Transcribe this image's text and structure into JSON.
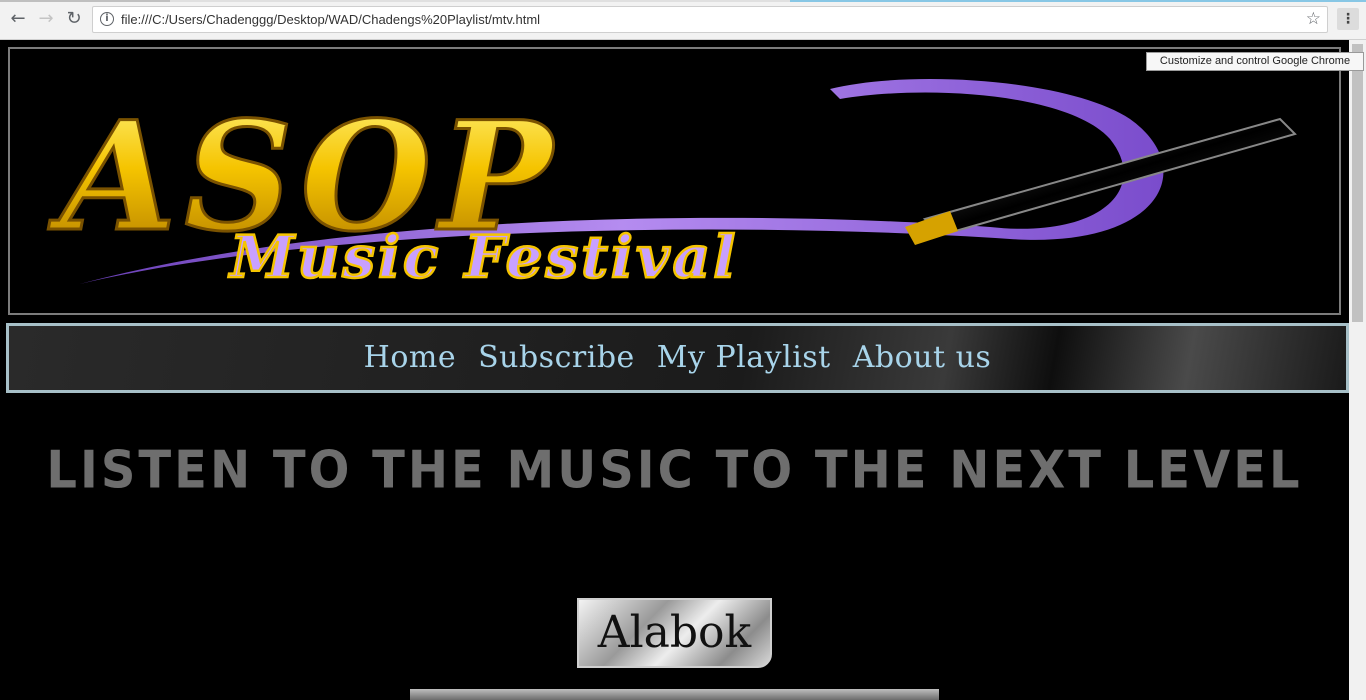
{
  "browser": {
    "url": "file:///C:/Users/Chadenggg/Desktop/WAD/Chadengs%20Playlist/mtv.html",
    "tooltip": "Customize and control Google Chrome",
    "icons": [
      "back-arrow-icon",
      "forward-arrow-icon",
      "reload-icon",
      "info-icon",
      "star-icon",
      "menu-icon"
    ]
  },
  "banner": {
    "logo_main": "ASOP",
    "logo_sub": "Music Festival"
  },
  "nav": {
    "items": [
      {
        "label": "Home"
      },
      {
        "label": "Subscribe"
      },
      {
        "label": "My Playlist"
      },
      {
        "label": "About us"
      }
    ]
  },
  "main": {
    "headline": "LISTEN TO THE MUSIC TO THE NEXT LEVEL",
    "feature_label": "Alabok"
  },
  "colors": {
    "nav_text": "#a8d4ea",
    "headline": "#6e6e6e",
    "logo_gold": "#f5c400",
    "logo_purple": "#9b6ad8"
  }
}
